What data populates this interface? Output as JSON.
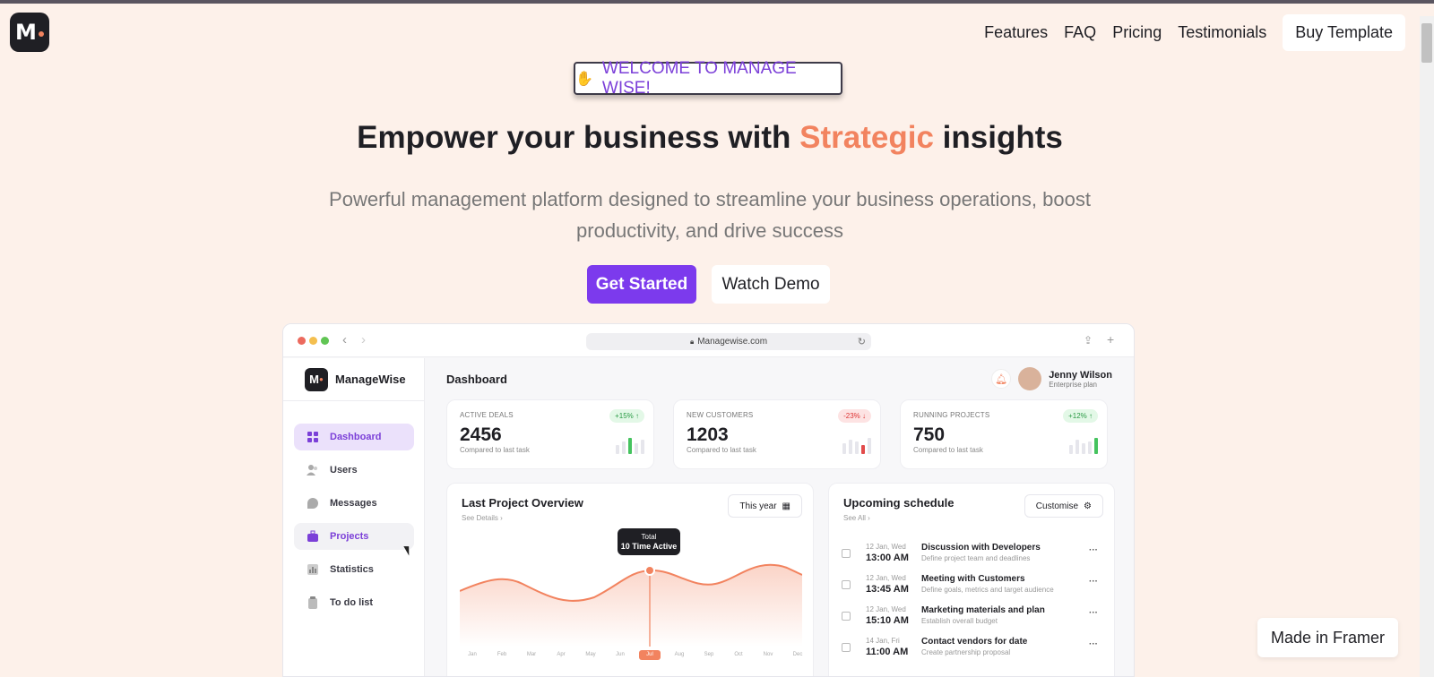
{
  "brand": {
    "logo_letter": "M",
    "accent_color": "#f2835f",
    "primary_color": "#7c3aed"
  },
  "nav": {
    "features": "Features",
    "faq": "FAQ",
    "pricing": "Pricing",
    "testimonials": "Testimonials",
    "buy": "Buy Template"
  },
  "hero": {
    "welcome": "WELCOME TO MANAGE WISE!",
    "title_before": "Empower your business with ",
    "title_accent": "Strategic",
    "title_after": " insights",
    "subtitle": "Powerful management platform designed to streamline your business operations, boost productivity, and drive success",
    "cta_primary": "Get Started",
    "cta_secondary": "Watch Demo"
  },
  "browser": {
    "url": "Managewise.com"
  },
  "app": {
    "brand_name": "ManageWise",
    "sidebar": [
      {
        "label": "Dashboard",
        "icon": "grid-icon"
      },
      {
        "label": "Users",
        "icon": "users-icon"
      },
      {
        "label": "Messages",
        "icon": "chat-icon"
      },
      {
        "label": "Projects",
        "icon": "briefcase-icon"
      },
      {
        "label": "Statistics",
        "icon": "chart-icon"
      },
      {
        "label": "To do list",
        "icon": "clipboard-icon"
      }
    ],
    "page_title": "Dashboard",
    "user": {
      "name": "Jenny Wilson",
      "plan": "Enterprise plan"
    },
    "stats": [
      {
        "label": "ACTIVE DEALS",
        "value": "2456",
        "compare": "Compared to last task",
        "badge": "+15% ↑",
        "trend": "up"
      },
      {
        "label": "NEW CUSTOMERS",
        "value": "1203",
        "compare": "Compared to last task",
        "badge": "-23% ↓",
        "trend": "down"
      },
      {
        "label": "RUNNING PROJECTS",
        "value": "750",
        "compare": "Compared to last task",
        "badge": "+12% ↑",
        "trend": "up"
      }
    ],
    "overview": {
      "title": "Last Project Overview",
      "link": "See Details",
      "filter": "This year",
      "tooltip_label": "Total",
      "tooltip_value": "10 Time Active",
      "months": [
        "Jan",
        "Feb",
        "Mar",
        "Apr",
        "May",
        "Jun",
        "Jul",
        "Aug",
        "Sep",
        "Oct",
        "Nov",
        "Dec"
      ],
      "selected_month": "Jul"
    },
    "schedule": {
      "title": "Upcoming schedule",
      "link": "See All",
      "button": "Customise",
      "items": [
        {
          "date": "12 Jan, Wed",
          "time": "13:00 AM",
          "title": "Discussion with Developers",
          "desc": "Define project team and deadlines"
        },
        {
          "date": "12 Jan, Wed",
          "time": "13:45 AM",
          "title": "Meeting with Customers",
          "desc": "Define goals, metrics and target audience"
        },
        {
          "date": "12 Jan, Wed",
          "time": "15:10 AM",
          "title": "Marketing materials and plan",
          "desc": "Establish overall budget"
        },
        {
          "date": "14 Jan, Fri",
          "time": "11:00 AM",
          "title": "Contact vendors for date",
          "desc": "Create partnership proposal"
        }
      ]
    }
  },
  "badge_framer": "Made in Framer"
}
